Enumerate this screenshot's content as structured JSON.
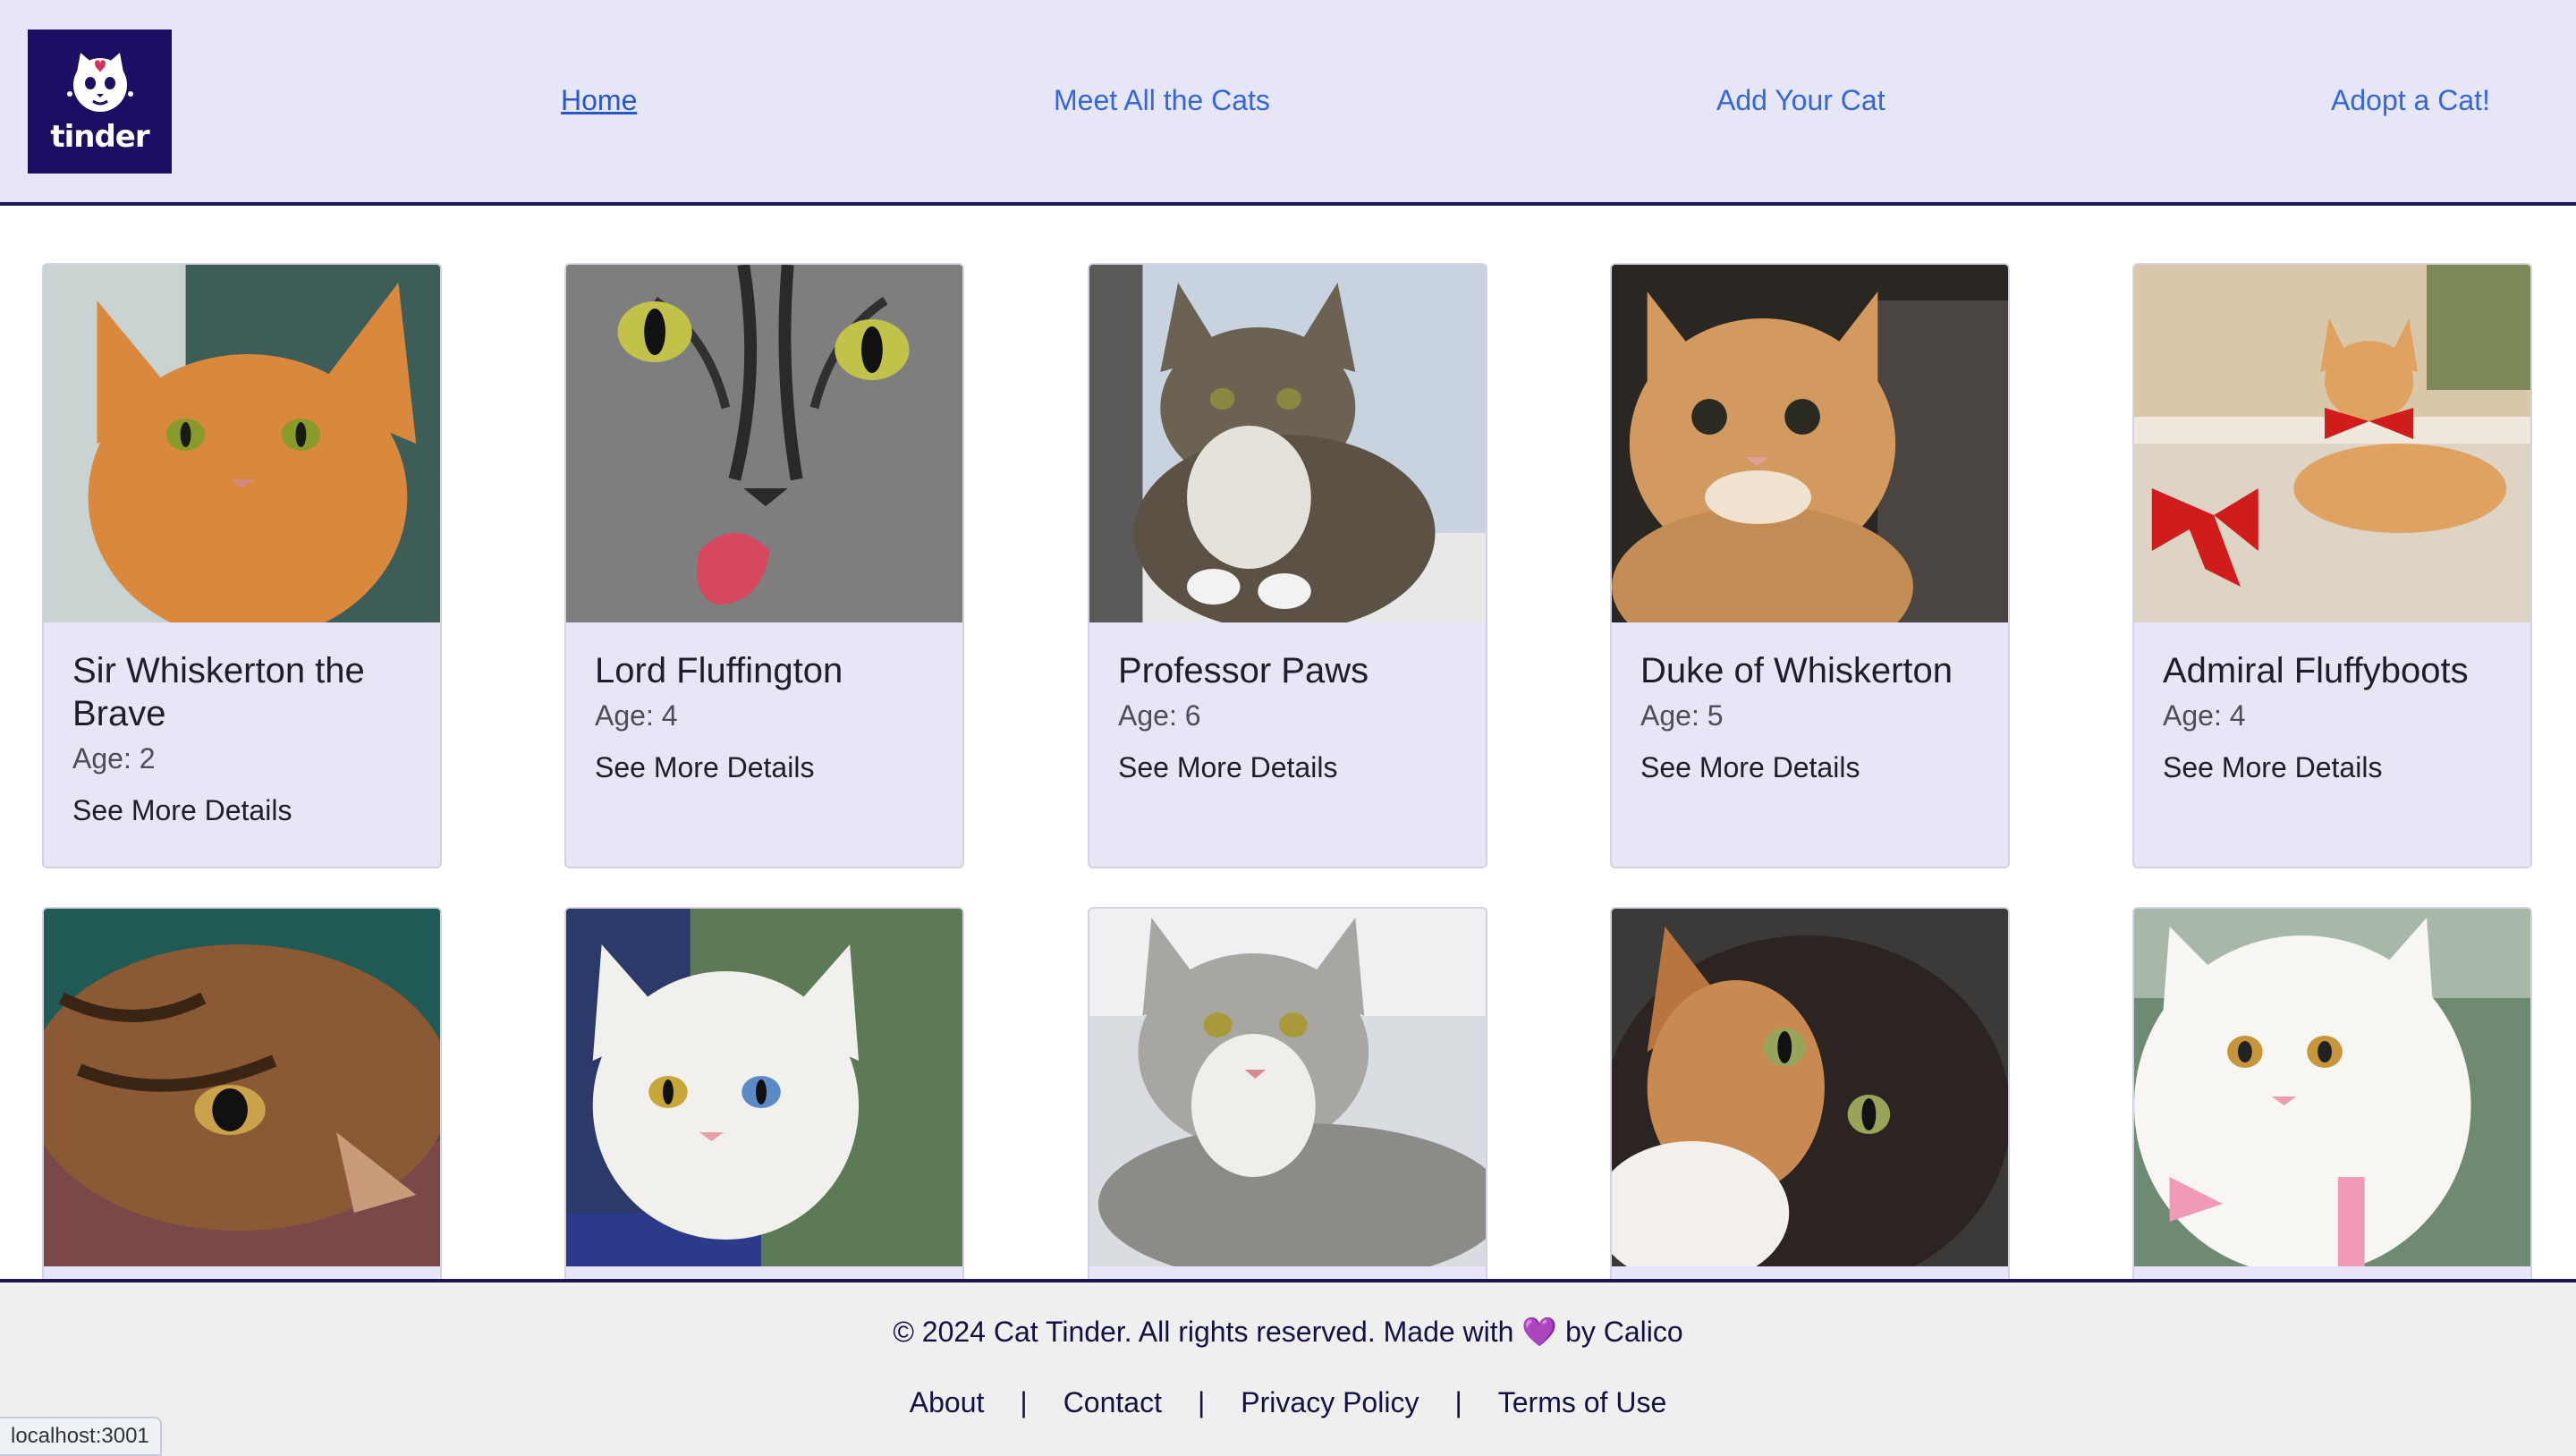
{
  "header": {
    "logo_text": "tinder",
    "nav": [
      {
        "label": "Home"
      },
      {
        "label": "Meet All the Cats"
      },
      {
        "label": "Add Your Cat"
      },
      {
        "label": "Adopt a Cat!"
      }
    ]
  },
  "cats": [
    {
      "name": "Sir Whiskerton the Brave",
      "age": "Age: 2",
      "details": "See More Details",
      "fur": "#d9883d"
    },
    {
      "name": "Lord Fluffington",
      "age": "Age: 4",
      "details": "See More Details",
      "fur": "#8a8a8a"
    },
    {
      "name": "Professor Paws",
      "age": "Age: 6",
      "details": "See More Details",
      "fur": "#6b6253"
    },
    {
      "name": "Duke of Whiskerton",
      "age": "Age: 5",
      "details": "See More Details",
      "fur": "#d29a5e"
    },
    {
      "name": "Admiral Fluffyboots",
      "age": "Age: 4",
      "details": "See More Details",
      "fur": "#dfa260"
    }
  ],
  "cats_row2": [
    {
      "fur": "#8b5a35"
    },
    {
      "fur": "#f2f0ec"
    },
    {
      "fur": "#a8a6a2"
    },
    {
      "fur": "#2b2420"
    },
    {
      "fur": "#f7f6f3"
    }
  ],
  "footer": {
    "copyright": "© 2024 Cat Tinder. All rights reserved. Made with 💜 by Calico",
    "links": [
      "About",
      "Contact",
      "Privacy Policy",
      "Terms of Use"
    ],
    "separator": "|"
  },
  "status_bar": {
    "url": "localhost:3001"
  }
}
